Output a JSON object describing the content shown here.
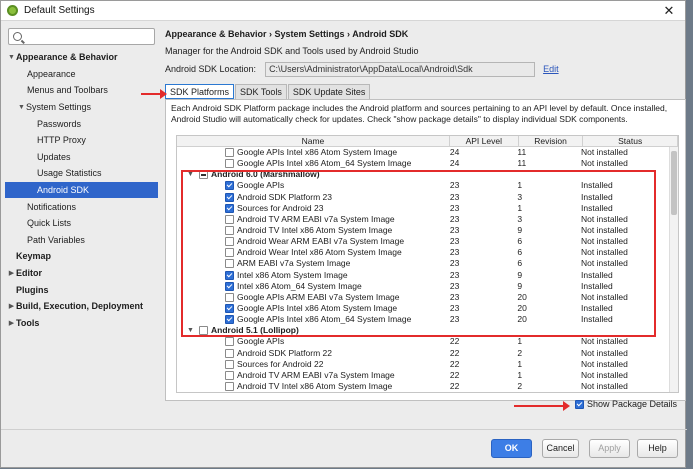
{
  "window": {
    "title": "Default Settings",
    "close_glyph": "✕"
  },
  "sidebar": {
    "search_placeholder": "",
    "items": [
      {
        "label": "Appearance & Behavior",
        "level": 0,
        "bold": true,
        "expanded": true
      },
      {
        "label": "Appearance",
        "level": 1
      },
      {
        "label": "Menus and Toolbars",
        "level": 1
      },
      {
        "label": "System Settings",
        "level": 1,
        "expanded": true
      },
      {
        "label": "Passwords",
        "level": 2
      },
      {
        "label": "HTTP Proxy",
        "level": 2
      },
      {
        "label": "Updates",
        "level": 2
      },
      {
        "label": "Usage Statistics",
        "level": 2
      },
      {
        "label": "Android SDK",
        "level": 2,
        "selected": true
      },
      {
        "label": "Notifications",
        "level": 1
      },
      {
        "label": "Quick Lists",
        "level": 1
      },
      {
        "label": "Path Variables",
        "level": 1
      },
      {
        "label": "Keymap",
        "level": 0,
        "bold": true
      },
      {
        "label": "Editor",
        "level": 0,
        "bold": true,
        "collapsed": true
      },
      {
        "label": "Plugins",
        "level": 0,
        "bold": true
      },
      {
        "label": "Build, Execution, Deployment",
        "level": 0,
        "bold": true,
        "collapsed": true
      },
      {
        "label": "Tools",
        "level": 0,
        "bold": true,
        "collapsed": true
      }
    ]
  },
  "main": {
    "breadcrumb": "Appearance & Behavior › System Settings › Android SDK",
    "description": "Manager for the Android SDK and Tools used by Android Studio",
    "location_label": "Android SDK Location:",
    "location_value": "C:\\Users\\Administrator\\AppData\\Local\\Android\\Sdk",
    "edit_label": "Edit",
    "tabs": [
      {
        "label": "SDK Platforms",
        "active": true
      },
      {
        "label": "SDK Tools"
      },
      {
        "label": "SDK Update Sites"
      }
    ],
    "panel_description": "Each Android SDK Platform package includes the Android platform and sources pertaining to an API level by default. Once installed, Android Studio will automatically check for updates. Check \"show package details\" to display individual SDK components.",
    "columns": {
      "name": "Name",
      "api": "API Level",
      "revision": "Revision",
      "status": "Status"
    },
    "rows": [
      {
        "type": "child",
        "checked": false,
        "name": "Google APIs Intel x86 Atom System Image",
        "api": "24",
        "rev": "11",
        "status": "Not installed"
      },
      {
        "type": "child",
        "checked": false,
        "name": "Google APIs Intel x86 Atom_64 System Image",
        "api": "24",
        "rev": "11",
        "status": "Not installed"
      },
      {
        "type": "group",
        "checkbox": "partial",
        "name": "Android 6.0 (Marshmallow)",
        "api": "",
        "rev": "",
        "status": ""
      },
      {
        "type": "child",
        "checked": true,
        "name": "Google APIs",
        "api": "23",
        "rev": "1",
        "status": "Installed"
      },
      {
        "type": "child",
        "checked": true,
        "name": "Android SDK Platform 23",
        "api": "23",
        "rev": "3",
        "status": "Installed"
      },
      {
        "type": "child",
        "checked": true,
        "name": "Sources for Android 23",
        "api": "23",
        "rev": "1",
        "status": "Installed"
      },
      {
        "type": "child",
        "checked": false,
        "name": "Android TV ARM EABI v7a System Image",
        "api": "23",
        "rev": "3",
        "status": "Not installed"
      },
      {
        "type": "child",
        "checked": false,
        "name": "Android TV Intel x86 Atom System Image",
        "api": "23",
        "rev": "9",
        "status": "Not installed"
      },
      {
        "type": "child",
        "checked": false,
        "name": "Android Wear ARM EABI v7a System Image",
        "api": "23",
        "rev": "6",
        "status": "Not installed"
      },
      {
        "type": "child",
        "checked": false,
        "name": "Android Wear Intel x86 Atom System Image",
        "api": "23",
        "rev": "6",
        "status": "Not installed"
      },
      {
        "type": "child",
        "checked": false,
        "name": "ARM EABI v7a System Image",
        "api": "23",
        "rev": "6",
        "status": "Not installed"
      },
      {
        "type": "child",
        "checked": true,
        "name": "Intel x86 Atom System Image",
        "api": "23",
        "rev": "9",
        "status": "Installed"
      },
      {
        "type": "child",
        "checked": true,
        "name": "Intel x86 Atom_64 System Image",
        "api": "23",
        "rev": "9",
        "status": "Installed"
      },
      {
        "type": "child",
        "checked": false,
        "name": "Google APIs ARM EABI v7a System Image",
        "api": "23",
        "rev": "20",
        "status": "Not installed"
      },
      {
        "type": "child",
        "checked": true,
        "name": "Google APIs Intel x86 Atom System Image",
        "api": "23",
        "rev": "20",
        "status": "Installed"
      },
      {
        "type": "child",
        "checked": true,
        "name": "Google APIs Intel x86 Atom_64 System Image",
        "api": "23",
        "rev": "20",
        "status": "Installed"
      },
      {
        "type": "group",
        "checkbox": "off",
        "name": "Android 5.1 (Lollipop)",
        "api": "",
        "rev": "",
        "status": ""
      },
      {
        "type": "child",
        "checked": false,
        "name": "Google APIs",
        "api": "22",
        "rev": "1",
        "status": "Not installed"
      },
      {
        "type": "child",
        "checked": false,
        "name": "Android SDK Platform 22",
        "api": "22",
        "rev": "2",
        "status": "Not installed"
      },
      {
        "type": "child",
        "checked": false,
        "name": "Sources for Android 22",
        "api": "22",
        "rev": "1",
        "status": "Not installed"
      },
      {
        "type": "child",
        "checked": false,
        "name": "Android TV ARM EABI v7a System Image",
        "api": "22",
        "rev": "1",
        "status": "Not installed"
      },
      {
        "type": "child",
        "checked": false,
        "name": "Android TV Intel x86 Atom System Image",
        "api": "22",
        "rev": "2",
        "status": "Not installed"
      }
    ],
    "show_details_label": "Show Package Details",
    "show_details_checked": true
  },
  "footer": {
    "ok": "OK",
    "cancel": "Cancel",
    "apply": "Apply",
    "help": "Help"
  },
  "colors": {
    "accent": "#2f65ca",
    "annotation": "#e32b2b"
  }
}
